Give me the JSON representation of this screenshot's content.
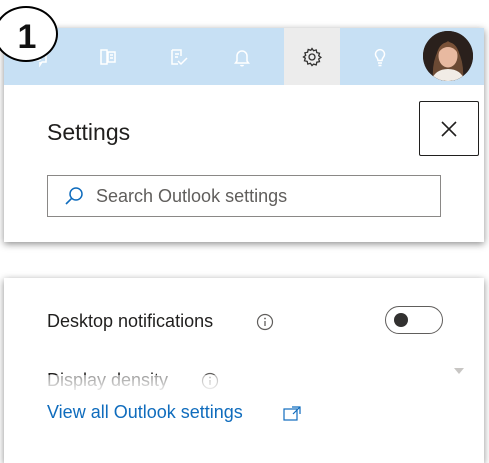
{
  "step_badge": "1",
  "settings_panel": {
    "title": "Settings",
    "close_symbol": "✕",
    "search": {
      "placeholder": "Search Outlook settings"
    }
  },
  "header_icons": [
    "teams-icon",
    "office-apps-icon",
    "todo-icon",
    "bell-icon",
    "gear-icon",
    "lightbulb-icon"
  ],
  "quick_settings": {
    "desktop_notifications": {
      "label": "Desktop notifications",
      "toggle_on": false
    },
    "display_density": {
      "label": "Display density"
    },
    "view_all_link": "View all Outlook settings"
  },
  "colors": {
    "header_bg": "#c7e0f4",
    "icon_color": "#ffffff",
    "active_icon_bg": "#ececec",
    "link": "#0f6cbd",
    "text": "#201f1e"
  }
}
